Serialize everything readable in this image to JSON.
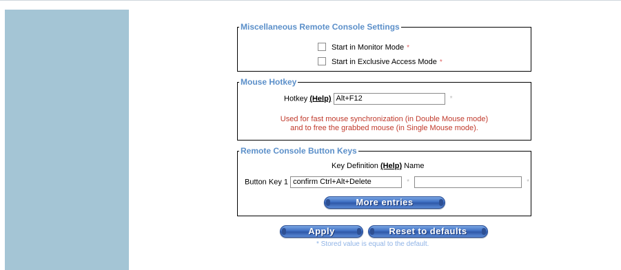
{
  "misc_section": {
    "legend": "Miscellaneous Remote Console Settings",
    "monitor_mode_label": "Start in Monitor Mode",
    "exclusive_access_label": "Start in Exclusive Access Mode",
    "required_mark": "*"
  },
  "mouse_section": {
    "legend": "Mouse Hotkey",
    "hotkey_label": "Hotkey",
    "help_link": "(Help)",
    "hotkey_value": "Alt+F12",
    "required_mark": "*",
    "note_line1": "Used for fast mouse synchronization (in Double Mouse mode)",
    "note_line2": "and to free the grabbed mouse (in Single Mouse mode)."
  },
  "keys_section": {
    "legend": "Remote Console Button Keys",
    "key_definition_header": "Key Definition",
    "help_link": "(Help)",
    "name_header": "Name",
    "row_label": "Button Key 1",
    "key_value": "confirm Ctrl+Alt+Delete",
    "name_value": "",
    "required_mark": "*",
    "more_entries_label": "More entries"
  },
  "actions": {
    "apply_label": "Apply",
    "reset_label": "Reset to defaults",
    "stored_note": "* Stored value is equal to the default."
  },
  "colors": {
    "sidebar": "#a4c5d5",
    "legend_text": "#5b8fc9",
    "warning_text": "#c0392b",
    "button_blue": "#3f6fc3"
  }
}
